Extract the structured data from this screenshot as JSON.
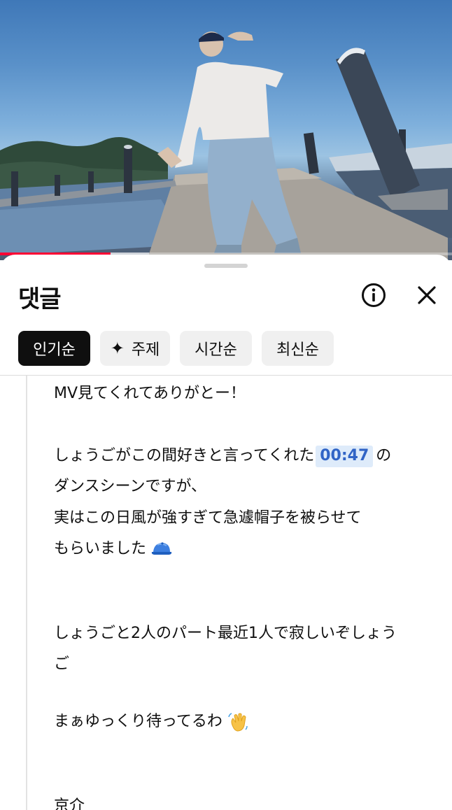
{
  "video": {
    "progress_fraction": 0.245,
    "buffered_fraction": 0.33,
    "colors": {
      "played": "#ff0033",
      "sky": "#6aa0d4"
    }
  },
  "comments_panel": {
    "title": "댓글",
    "info_icon": "info-icon",
    "close_icon": "close-icon",
    "sort_chips": [
      {
        "label": "인기순",
        "active": true
      },
      {
        "label": "주제",
        "icon": "sparkle-icon",
        "active": false
      },
      {
        "label": "시간순",
        "active": false
      },
      {
        "label": "최신순",
        "active": false
      }
    ]
  },
  "comment": {
    "lines": {
      "l1": "MV見てくれてありがとー！",
      "l2_before": "しょうごがこの間好きと言ってくれた",
      "l2_timestamp": "00:47",
      "l2_after": "の",
      "l3": "ダンスシーンですが、",
      "l4": "実はこの日風が強すぎて急遽帽子を被らせて",
      "l5": "もらいました",
      "l6": "しょうごと2人のパート最近1人で寂しいぞしょう",
      "l7": "ご",
      "l8": "まぁゆっくり待ってるわ",
      "l9": "京介"
    },
    "emojis": [
      "cap-emoji",
      "waving-hand-emoji"
    ],
    "colors": {
      "timestamp_text": "#3164c6",
      "timestamp_bg": "#deebfa"
    }
  }
}
